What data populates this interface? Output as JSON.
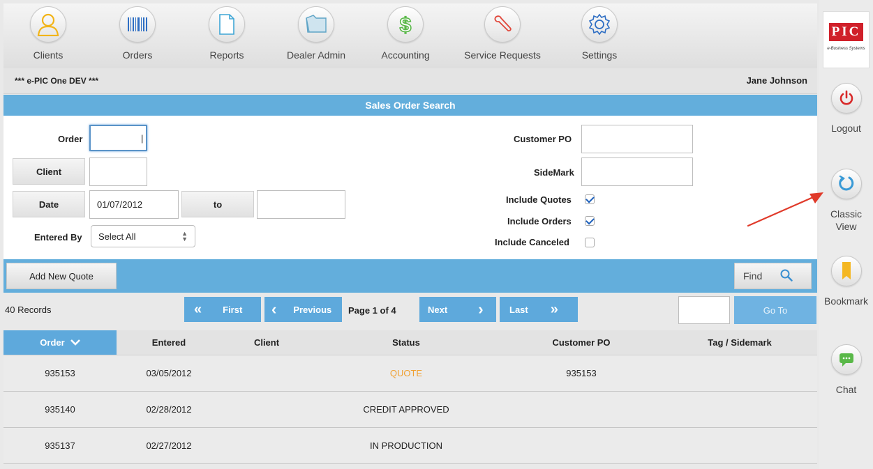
{
  "nav": {
    "items": [
      {
        "label": "Clients",
        "icon": "person-icon"
      },
      {
        "label": "Orders",
        "icon": "barcode-icon"
      },
      {
        "label": "Reports",
        "icon": "document-icon"
      },
      {
        "label": "Dealer Admin",
        "icon": "folder-icon"
      },
      {
        "label": "Accounting",
        "icon": "dollar-icon"
      },
      {
        "label": "Service Requests",
        "icon": "wrench-icon"
      },
      {
        "label": "Settings",
        "icon": "gear-icon"
      }
    ]
  },
  "brand": {
    "logo_text": "PIC",
    "tagline": "e-Business Systems",
    "accent": "#d0202a"
  },
  "rail": {
    "logout_label": "Logout",
    "classic_label_1": "Classic",
    "classic_label_2": "View",
    "bookmark_label": "Bookmark",
    "chat_label": "Chat"
  },
  "header": {
    "environment": "*** e-PIC One DEV ***",
    "user": "Jane Johnson"
  },
  "panel": {
    "title": "Sales Order Search"
  },
  "form": {
    "order_label": "Order",
    "order_value": "|",
    "client_button": "Client",
    "client_value": "",
    "date_button": "Date",
    "date_from": "01/07/2012",
    "date_to_button": "to",
    "date_to": "",
    "entered_by_label": "Entered By",
    "entered_by_value": "Select All",
    "customer_po_label": "Customer PO",
    "customer_po_value": "",
    "sidemark_label": "SideMark",
    "sidemark_value": "",
    "include_quotes_label": "Include Quotes",
    "include_quotes": true,
    "include_orders_label": "Include Orders",
    "include_orders": true,
    "include_canceled_label": "Include Canceled",
    "include_canceled": false
  },
  "actions": {
    "add_quote": "Add New Quote",
    "find": "Find"
  },
  "pager": {
    "records": "40 Records",
    "first": "First",
    "previous": "Previous",
    "page_info": "Page  1  of  4",
    "next": "Next",
    "last": "Last",
    "goto": "Go To",
    "goto_value": ""
  },
  "table": {
    "columns": [
      "Order",
      "Entered",
      "Client",
      "Status",
      "Customer PO",
      "Tag / Sidemark"
    ],
    "rows": [
      {
        "order": "935153",
        "entered": "03/05/2012",
        "client": "",
        "status": "QUOTE",
        "customer_po": "935153",
        "tag": ""
      },
      {
        "order": "935140",
        "entered": "02/28/2012",
        "client": "",
        "status": "CREDIT APPROVED",
        "customer_po": "",
        "tag": ""
      },
      {
        "order": "935137",
        "entered": "02/27/2012",
        "client": "",
        "status": "IN PRODUCTION",
        "customer_po": "",
        "tag": ""
      }
    ]
  },
  "colors": {
    "accent_blue": "#63aedc",
    "quote_status": "#f0a030",
    "annotation_arrow": "#e03a2a"
  }
}
